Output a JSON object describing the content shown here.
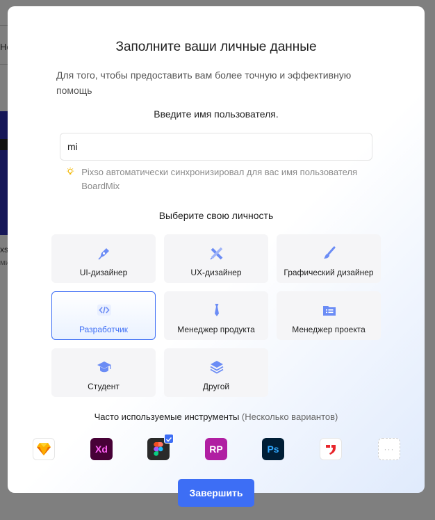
{
  "background": {
    "snippets": [
      "Но",
      "ria",
      "X",
      "e",
      "xs",
      "ми"
    ]
  },
  "modal": {
    "title": "Заполните ваши личные данные",
    "subtitle": "Для того, чтобы предоставить вам более точную и эффективную помощь",
    "username_label": "Введите имя пользователя.",
    "username_value": "mi",
    "hint": "Pixso автоматически синхронизировал для вас имя пользователя BoardMix",
    "identity_label": "Выберите свою личность",
    "roles": [
      {
        "label": "UI-дизайнер",
        "icon": "pen-icon",
        "selected": false
      },
      {
        "label": "UX-дизайнер",
        "icon": "pencil-ruler-icon",
        "selected": false
      },
      {
        "label": "Графический дизайнер",
        "icon": "brush-icon",
        "selected": false
      },
      {
        "label": "Разработчик",
        "icon": "code-icon",
        "selected": true
      },
      {
        "label": "Менеджер продукта",
        "icon": "tie-icon",
        "selected": false
      },
      {
        "label": "Менеджер проекта",
        "icon": "folder-list-icon",
        "selected": false
      },
      {
        "label": "Студент",
        "icon": "graduation-cap-icon",
        "selected": false
      },
      {
        "label": "Другой",
        "icon": "layers-icon",
        "selected": false
      }
    ],
    "tools_label": "Часто используемые инструменты",
    "tools_note": "(Несколько вариантов)",
    "tools": [
      {
        "name": "sketch-icon",
        "text": "",
        "checked": false
      },
      {
        "name": "adobe-xd-icon",
        "text": "Xd",
        "checked": false
      },
      {
        "name": "figma-icon",
        "text": "",
        "checked": true
      },
      {
        "name": "axure-rp-icon",
        "text": "RP",
        "checked": false
      },
      {
        "name": "photoshop-icon",
        "text": "Ps",
        "checked": false
      },
      {
        "name": "mockplus-icon",
        "text": "",
        "checked": false
      },
      {
        "name": "more-icon",
        "text": "···",
        "checked": false
      }
    ],
    "finish_label": "Завершить"
  },
  "colors": {
    "accent": "#3d6ef5",
    "icon": "#6b8cf5"
  }
}
